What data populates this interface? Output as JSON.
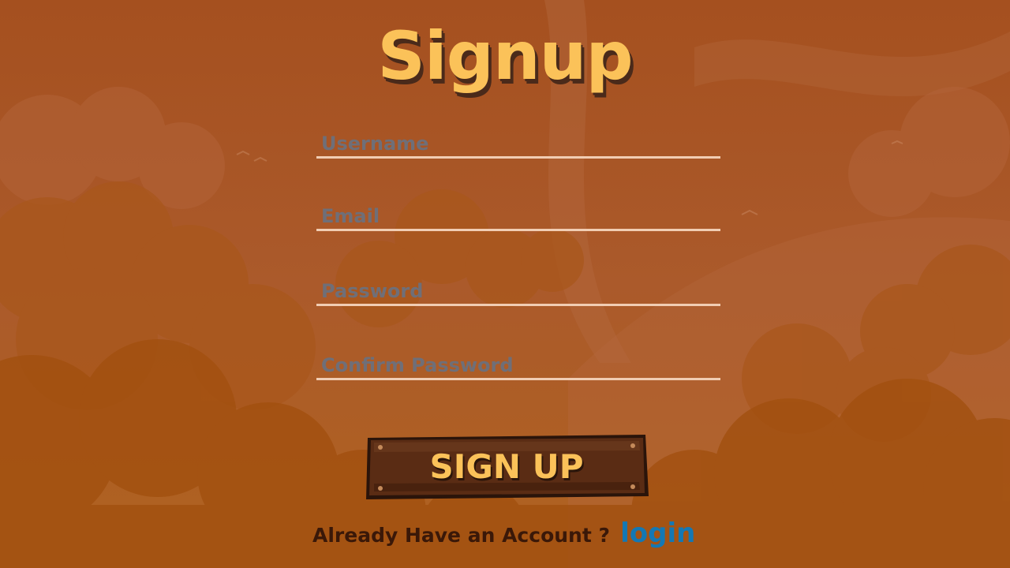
{
  "screen": {
    "title": "Signup"
  },
  "form": {
    "username_placeholder": "Username",
    "email_placeholder": "Email",
    "password_placeholder": "Password",
    "confirm_password_placeholder": "Confirm Password",
    "submit_label": "SIGN UP"
  },
  "footer": {
    "question": "Already Have an Account ?",
    "login_link": "login"
  },
  "colors": {
    "background": "#a95323",
    "title": "#fbc259",
    "title_shadow": "#4a2a1a",
    "field_underline": "#f1cdb3",
    "placeholder": "#6f6f78",
    "button_wood": "#5a2c14",
    "button_text": "#fbc259",
    "footer_text": "#3a1808",
    "link": "#1478b4"
  }
}
